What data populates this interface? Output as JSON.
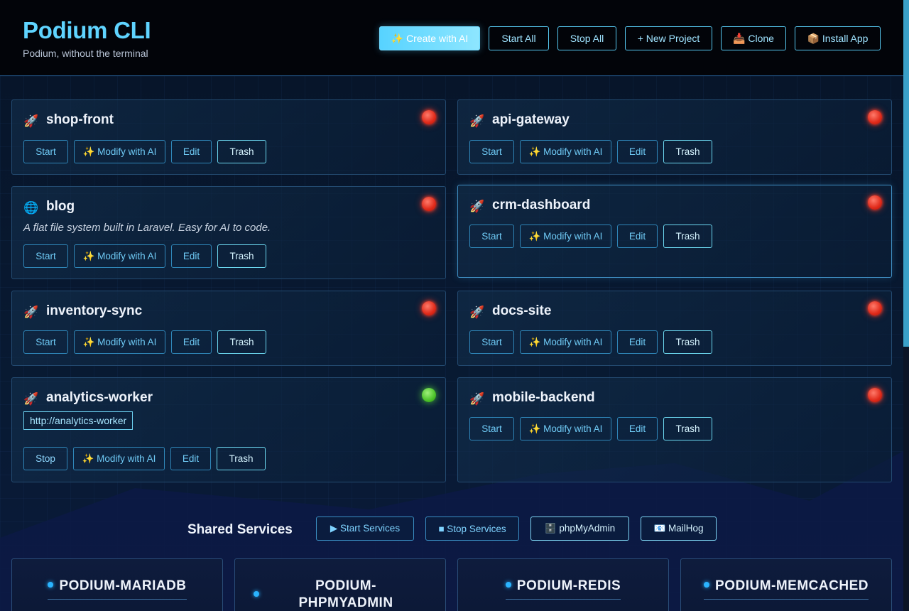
{
  "header": {
    "title": "Podium CLI",
    "subtitle": "Podium, without the terminal",
    "buttons": {
      "create_ai": "✨ Create with AI",
      "start_all": "Start All",
      "stop_all": "Stop All",
      "new_project": "+ New Project",
      "clone": "📥 Clone",
      "install_app": "📦 Install App"
    }
  },
  "actions": {
    "start": "Start",
    "stop": "Stop",
    "modify_ai": "✨ Modify with AI",
    "edit": "Edit",
    "trash": "Trash"
  },
  "projects": [
    {
      "name": "shop-front",
      "icon": "🚀",
      "icon_name": "rocket-icon",
      "status": "stopped"
    },
    {
      "name": "api-gateway",
      "icon": "🚀",
      "icon_name": "rocket-icon",
      "status": "stopped"
    },
    {
      "name": "blog",
      "icon": "🌐",
      "icon_name": "globe-icon",
      "status": "stopped",
      "description": "A flat file system built in Laravel. Easy for AI to code."
    },
    {
      "name": "crm-dashboard",
      "icon": "🚀",
      "icon_name": "rocket-icon",
      "status": "stopped"
    },
    {
      "name": "inventory-sync",
      "icon": "🚀",
      "icon_name": "rocket-icon",
      "status": "stopped"
    },
    {
      "name": "docs-site",
      "icon": "🚀",
      "icon_name": "rocket-icon",
      "status": "stopped"
    },
    {
      "name": "analytics-worker",
      "icon": "🚀",
      "icon_name": "rocket-icon",
      "status": "running",
      "url": "http://analytics-worker"
    },
    {
      "name": "mobile-backend",
      "icon": "🚀",
      "icon_name": "rocket-icon",
      "status": "stopped"
    }
  ],
  "shared_services": {
    "title": "Shared Services",
    "buttons": {
      "start": "▶ Start Services",
      "stop": "■ Stop Services",
      "phpmyadmin": "🗄️ phpMyAdmin",
      "mailhog": "📧 MailHog"
    },
    "services": [
      {
        "name": "PODIUM-MARIADB"
      },
      {
        "name": "PODIUM-PHPMYADMIN",
        "lines": [
          "PODIUM-",
          "PHPMYADMIN"
        ]
      },
      {
        "name": "PODIUM-REDIS"
      },
      {
        "name": "PODIUM-MEMCACHED"
      }
    ]
  },
  "colors": {
    "accent": "#5fd4ff",
    "status_stopped": "#e02a1a",
    "status_running": "#4cc22a"
  }
}
